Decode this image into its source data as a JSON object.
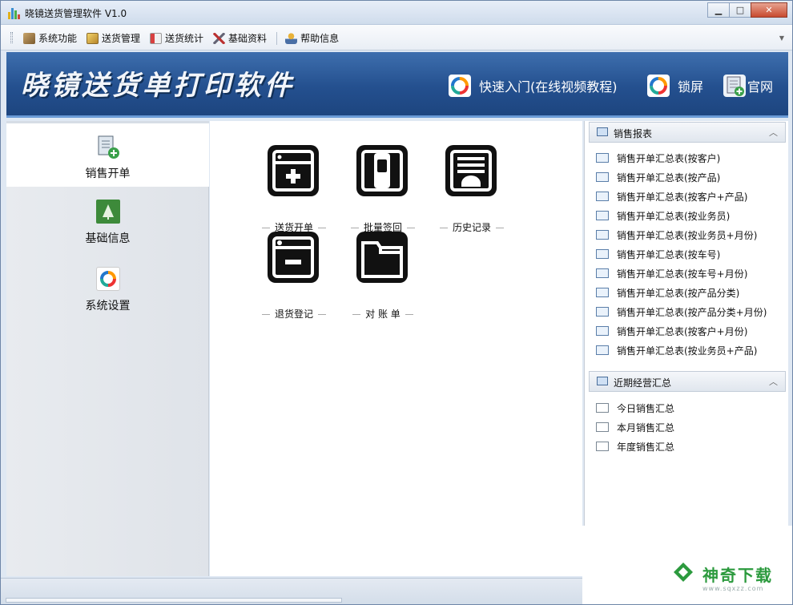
{
  "window": {
    "title": "晓镜送货管理软件 V1.0",
    "minimize": "▁",
    "maximize": "□",
    "close": "✕"
  },
  "menubar": {
    "items": [
      {
        "label": "系统功能",
        "icon": "system-icon"
      },
      {
        "label": "送货管理",
        "icon": "delivery-icon"
      },
      {
        "label": "送货统计",
        "icon": "stats-icon"
      },
      {
        "label": "基础资料",
        "icon": "tools-icon"
      },
      {
        "label": "帮助信息",
        "icon": "help-icon"
      }
    ]
  },
  "banner": {
    "logo_text": "晓镜送货单打印软件",
    "links": [
      {
        "label": "快速入门(在线视频教程)",
        "icon": "picasa-icon"
      },
      {
        "label": "锁屏",
        "icon": "picasa-icon"
      },
      {
        "label": "官网",
        "icon": "notebook-add-icon"
      }
    ]
  },
  "leftnav": {
    "items": [
      {
        "label": "销售开单",
        "icon": "notebook-add-icon",
        "active": true
      },
      {
        "label": "基础信息",
        "icon": "tree-icon",
        "active": false
      },
      {
        "label": "系统设置",
        "icon": "picasa-icon",
        "active": false
      }
    ]
  },
  "main": {
    "tiles": [
      {
        "label": "送货开单",
        "icon": "window-plus-icon"
      },
      {
        "label": "批量签回",
        "icon": "phone-icon"
      },
      {
        "label": "历史记录",
        "icon": "document-upload-icon"
      },
      {
        "label": "退货登记",
        "icon": "window-minus-icon"
      },
      {
        "label": "对 账 单",
        "icon": "folder-icon"
      }
    ]
  },
  "rightpanel": {
    "sales_report": {
      "title": "销售报表",
      "items": [
        "销售开单汇总表(按客户)",
        "销售开单汇总表(按产品)",
        "销售开单汇总表(按客户+产品)",
        "销售开单汇总表(按业务员)",
        "销售开单汇总表(按业务员+月份)",
        "销售开单汇总表(按车号)",
        "销售开单汇总表(按车号+月份)",
        "销售开单汇总表(按产品分类)",
        "销售开单汇总表(按产品分类+月份)",
        "销售开单汇总表(按客户+月份)",
        "销售开单汇总表(按业务员+产品)"
      ]
    },
    "recent_summary": {
      "title": "近期经营汇总",
      "items": [
        "今日销售汇总",
        "本月销售汇总",
        "年度销售汇总"
      ]
    },
    "collapse_glyph": "︿"
  },
  "watermark": {
    "title": "神奇下载",
    "url": "www.sqxzz.com"
  },
  "colors": {
    "banner": "#24508f",
    "accent_green": "#2c9a3e"
  }
}
